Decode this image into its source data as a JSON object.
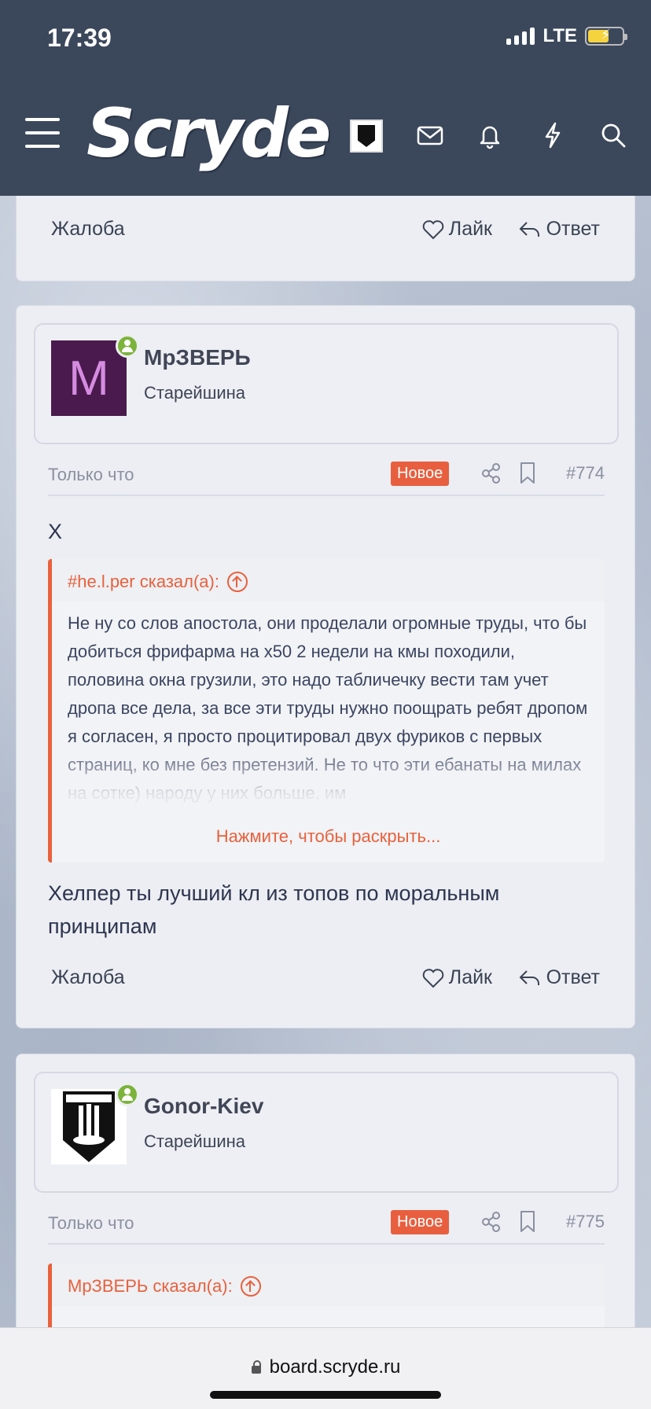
{
  "status_bar": {
    "time": "17:39",
    "network": "LTE"
  },
  "header": {
    "logo": "Scryde"
  },
  "previous_post": {
    "report_label": "Жалоба",
    "like_label": "Лайк",
    "reply_label": "Ответ"
  },
  "posts": [
    {
      "avatar_letter": "M",
      "username": "МрЗВЕРЬ",
      "user_title": "Старейшина",
      "time": "Только что",
      "badge": "Новое",
      "number": "#774",
      "text_before": "Х",
      "quote": {
        "author": "#he.l.per сказал(а):",
        "body": "Не ну со слов апостола, они проделали огромные труды, что бы добиться фрифарма на х50 2 недели на кмы походили, половина окна грузили, это надо табличечку вести там учет дропа все дела, за все эти труды нужно поощрать ребят дропом я согласен, я просто процитировал двух фуриков с первых страниц, ко мне без претензий. Не то что эти ебанаты на милах на сотке) народу у них больше, им",
        "expand": "Нажмите, чтобы раскрыть..."
      },
      "text_after": "Хелпер ты лучший кл из топов по моральным принципам",
      "report_label": "Жалоба",
      "like_label": "Лайк",
      "reply_label": "Ответ"
    },
    {
      "username": "Gonor-Kiev",
      "user_title": "Старейшина",
      "time": "Только что",
      "badge": "Новое",
      "number": "#775",
      "quote": {
        "author": "МрЗВЕРЬ сказал(а):"
      }
    }
  ],
  "browser": {
    "url": "board.scryde.ru"
  }
}
